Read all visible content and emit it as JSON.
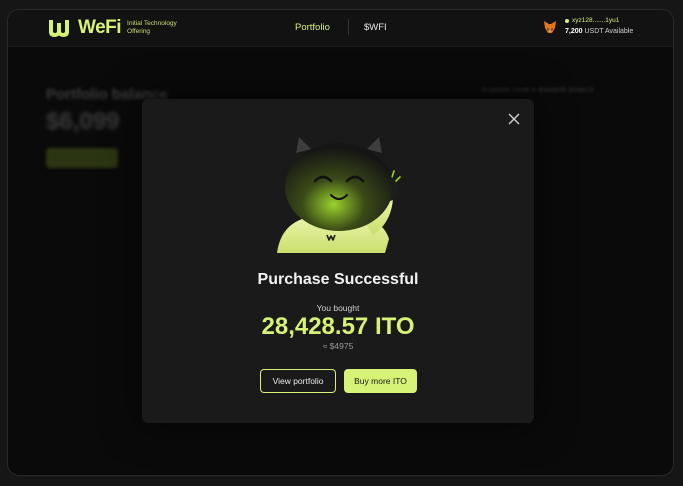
{
  "header": {
    "brand": "WeFi",
    "tagline": "Initial Technology Offering",
    "nav": {
      "portfolio": "Portfolio",
      "wfi": "$WFI"
    },
    "wallet": {
      "address": "xyz128.......1yu1",
      "balance_amount": "7,200",
      "balance_label": "USDT Available"
    }
  },
  "background": {
    "title": "Portfolio balance",
    "value": "$6,099",
    "side_text": "Available credit in $WalletB $WalUS"
  },
  "modal": {
    "title": "Purchase Successful",
    "subtitle": "You bought",
    "amount": "28,428.57 ITO",
    "approx": "≈ $4975",
    "view_portfolio": "View portfolio",
    "buy_more": "Buy more ITO"
  },
  "icons": {
    "logo": "wefi-logo-icon",
    "wallet": "metamask-fox-icon",
    "close": "close-icon",
    "mascot": "cat-mascot-illustration"
  },
  "colors": {
    "accent": "#d6f277",
    "background": "#0a0a0a",
    "modal": "#1a1a1a"
  }
}
